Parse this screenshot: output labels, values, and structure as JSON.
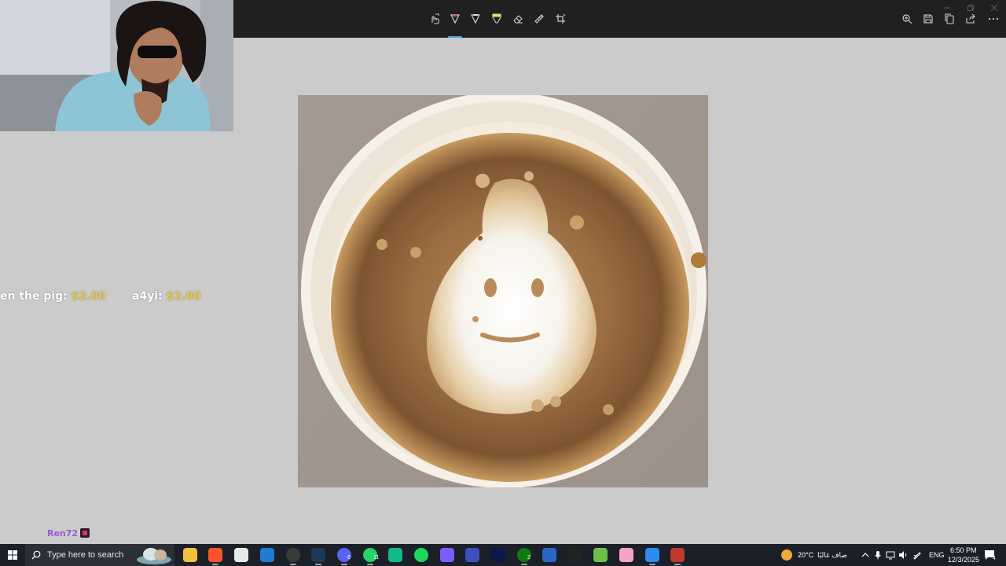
{
  "toolbar": {
    "tools": [
      "touch-writing-icon",
      "ballpoint-pen-icon",
      "pencil-icon",
      "highlighter-icon",
      "eraser-icon",
      "ruler-icon",
      "crop-icon"
    ],
    "active_tool": "ballpoint-pen-icon",
    "active_pen_color": "#e8417a",
    "highlighter_color": "#f4e542",
    "right_actions": [
      "zoom-icon",
      "save-icon",
      "copy-icon",
      "share-icon",
      "more-icon"
    ]
  },
  "overlay": {
    "donations": [
      {
        "name": "en the pig:",
        "amount": "$2.00"
      },
      {
        "name": "a4yi:",
        "amount": "$2.00"
      }
    ],
    "chat_user": "Ren72"
  },
  "taskbar": {
    "search_placeholder": "Type here to search",
    "apps": [
      "task-view",
      "file-explorer",
      "brave-browser",
      "microsoft-store",
      "outlook",
      "obs-studio",
      "steam",
      "discord",
      "whatsapp",
      "app-green",
      "spotify",
      "game-controller",
      "vpn-app",
      "terminal",
      "xbox",
      "word",
      "xd-pen",
      "minecraft",
      "paint",
      "snipping-tool",
      "power-toys"
    ],
    "badges": {
      "discord": "6",
      "whatsapp": "11",
      "xbox": "2"
    },
    "weather_temp": "20°C",
    "weather_text": "صاف غالبًا",
    "language": "ENG",
    "time": "6:50 PM",
    "date": "12/3/2025",
    "notification_count": "4"
  },
  "colors": {
    "accent": "#4aa3df",
    "canvas_bg": "#cbcbcb",
    "topbar_bg": "#202020",
    "taskbar_bg": "#1b1f27",
    "donation_amount": "#e2c84a",
    "chat_user": "#9b59d6"
  }
}
